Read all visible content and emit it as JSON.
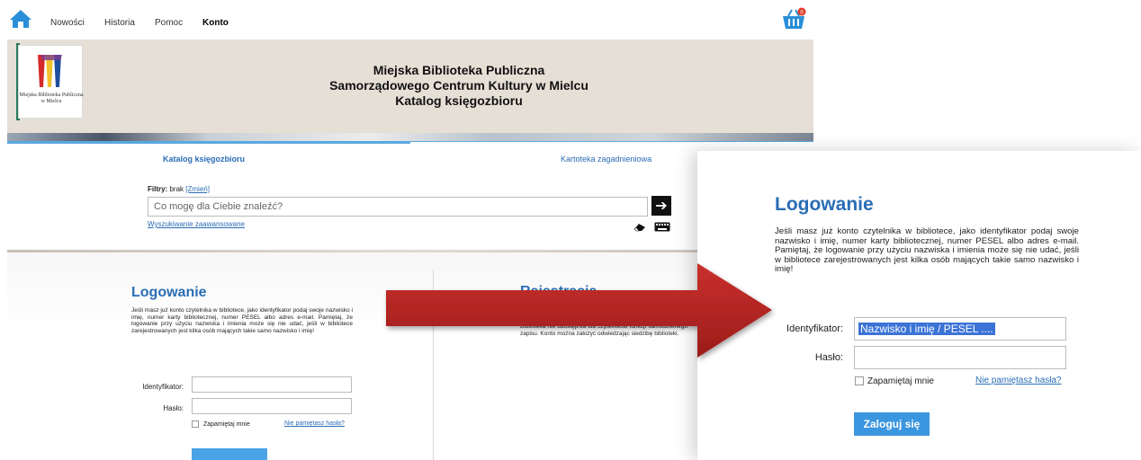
{
  "nav": {
    "items": [
      "Nowości",
      "Historia",
      "Pomoc",
      "Konto"
    ],
    "basket_count": "0"
  },
  "header": {
    "logo_text": "Miejska Biblioteka Publiczna w Mielcu",
    "title_line1": "Miejska Biblioteka Publiczna",
    "title_line2": "Samorządowego Centrum Kultury w Mielcu",
    "title_line3": "Katalog księgozbioru"
  },
  "tabs": [
    {
      "label": "Katalog księgozbioru",
      "active": true
    },
    {
      "label": "Kartoteka zagadnieniowa",
      "active": false
    }
  ],
  "search": {
    "filter_label": "Filtry:",
    "filter_value": "brak",
    "filter_change": "[Zmień]",
    "placeholder": "Co mogę dla Ciebie znaleźć?",
    "advanced_link": "Wyszukiwanie zaawansowane"
  },
  "login": {
    "title": "Logowanie",
    "description": "Jeśli masz już konto czytelnika w bibliotece, jako identyfikator podaj swoje nazwisko i imię, numer karty bibliotecznej, numer PESEL albo adres e-mail. Pamiętaj, że logowanie przy użyciu nazwiska i imienia może się nie udać, jeśli w bibliotece zarejestrowanych jest kilka osób mających takie samo nazwisko i imię!",
    "identifier_label": "Identyfikator:",
    "identifier_placeholder": "Nazwisko i imię / PESEL ....",
    "password_label": "Hasło:",
    "remember_label": "Zapamiętaj mnie",
    "forgot_link": "Nie pamiętasz hasła?",
    "submit_label": "Zaloguj się"
  },
  "registration": {
    "title": "Rejestracja",
    "description": "Biblioteka nie udostępnia dla czytelników funkcji samodzielnego zapisu. Konto można założyć odwiedzając siedzibę biblioteki."
  },
  "colors": {
    "accent_blue": "#2a6db5",
    "button_blue": "#3b96e0",
    "arrow_red": "#b8221f",
    "header_bg": "#e6dfd6"
  }
}
